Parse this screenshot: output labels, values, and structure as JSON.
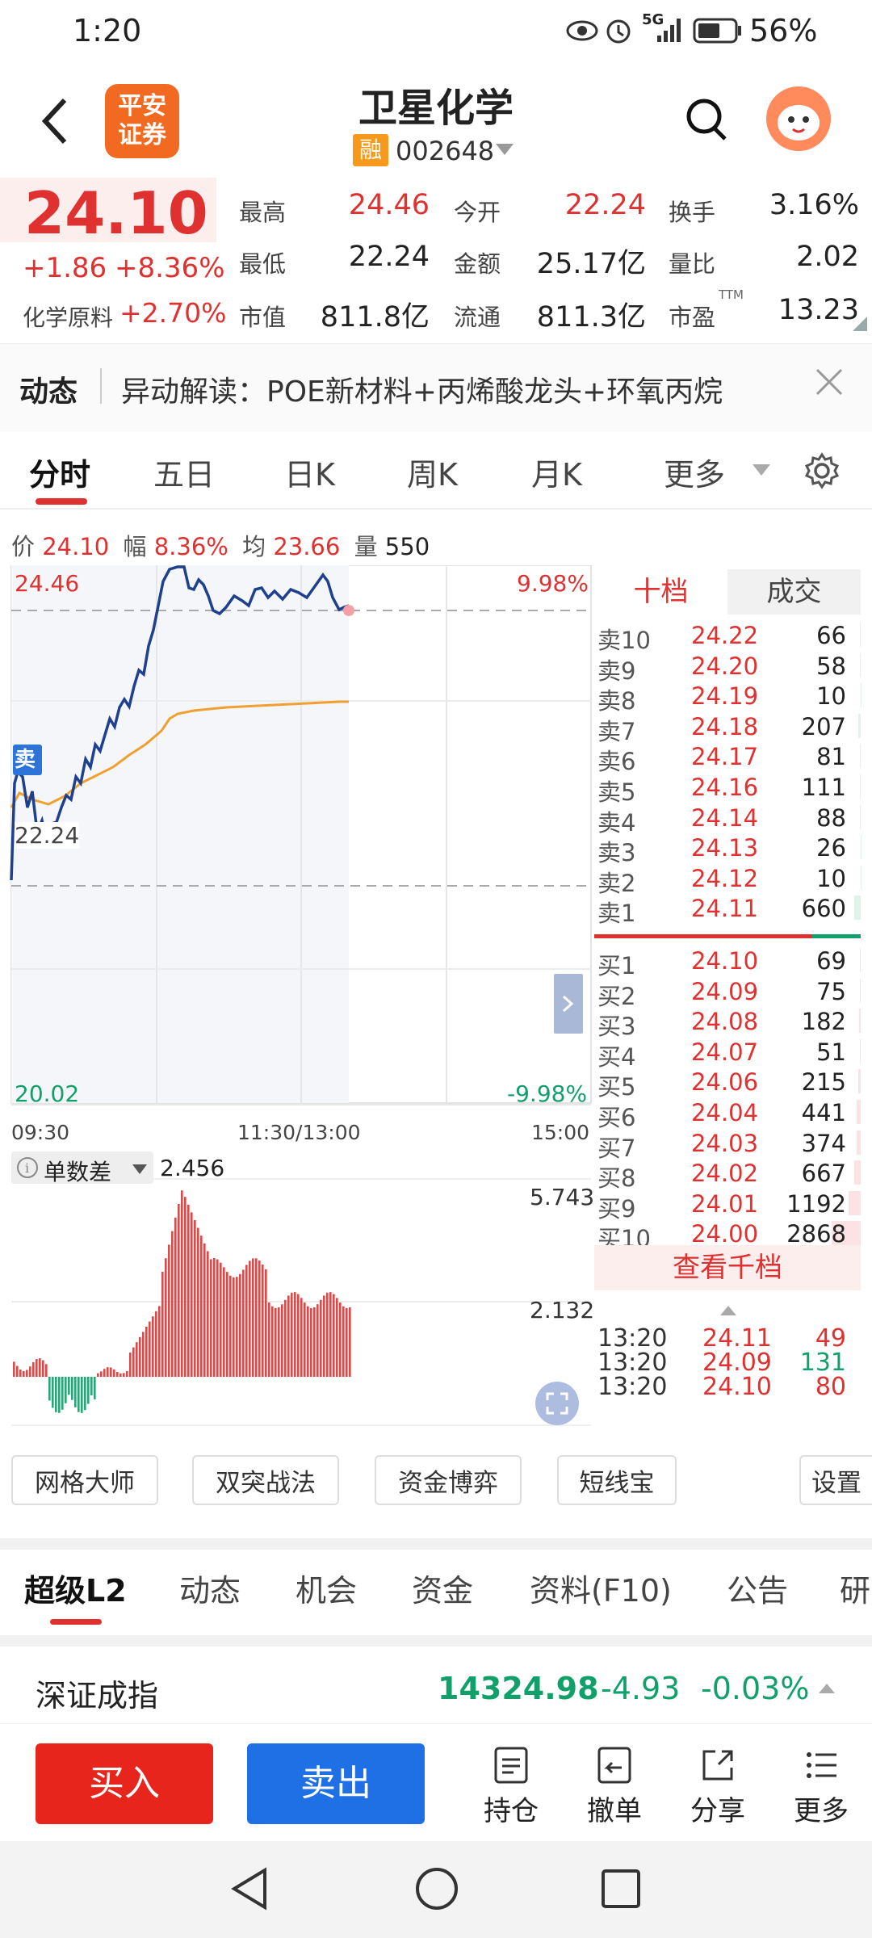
{
  "status": {
    "time": "1:20",
    "battery": "56%",
    "signal": "5G"
  },
  "header": {
    "title": "卫星化学",
    "rong_badge": "融",
    "code": "002648",
    "logo_line1": "平安",
    "logo_line2": "证券"
  },
  "quote": {
    "price": "24.10",
    "change": "+1.86",
    "change_pct": "+8.36%",
    "sector_label": "化学原料",
    "sector_change": "+2.70%",
    "cells": [
      {
        "label": "最高",
        "value": "24.46"
      },
      {
        "label": "今开",
        "value": "22.24"
      },
      {
        "label": "换手",
        "value": "3.16%"
      },
      {
        "label": "最低",
        "value": "22.24"
      },
      {
        "label": "金额",
        "value": "25.17亿"
      },
      {
        "label": "量比",
        "value": "2.02"
      },
      {
        "label": "市值",
        "value": "811.8亿"
      },
      {
        "label": "流通",
        "value": "811.3亿"
      },
      {
        "label": "市盈",
        "value": "13.23",
        "sup": "TTM"
      }
    ]
  },
  "news": {
    "label": "动态",
    "text": "异动解读：POE新材料+丙烯酸龙头+环氧丙烷"
  },
  "tabs": [
    "分时",
    "五日",
    "日K",
    "周K",
    "月K",
    "更多"
  ],
  "chart_header": {
    "price_label": "价",
    "price": "24.10",
    "range_label": "幅",
    "range": "8.36%",
    "avg_label": "均",
    "avg": "23.66",
    "vol_label": "量",
    "vol": "550"
  },
  "chart_labels": {
    "high": "24.46",
    "high_pct": "9.98%",
    "prev_close": "22.24",
    "low": "20.02",
    "low_pct": "-9.98%",
    "t_start": "09:30",
    "t_mid": "11:30/13:00",
    "t_end": "15:00",
    "sell_marker": "卖"
  },
  "indicator": {
    "name": "单数差",
    "value": "2.456",
    "max": "5.743",
    "mid": "2.132"
  },
  "book_tabs": {
    "active": "十档",
    "other": "成交"
  },
  "asks": [
    {
      "label": "卖10",
      "price": "24.22",
      "qty": "66"
    },
    {
      "label": "卖9",
      "price": "24.20",
      "qty": "58"
    },
    {
      "label": "卖8",
      "price": "24.19",
      "qty": "10"
    },
    {
      "label": "卖7",
      "price": "24.18",
      "qty": "207"
    },
    {
      "label": "卖6",
      "price": "24.17",
      "qty": "81"
    },
    {
      "label": "卖5",
      "price": "24.16",
      "qty": "111"
    },
    {
      "label": "卖4",
      "price": "24.14",
      "qty": "88"
    },
    {
      "label": "卖3",
      "price": "24.13",
      "qty": "26"
    },
    {
      "label": "卖2",
      "price": "24.12",
      "qty": "10"
    },
    {
      "label": "卖1",
      "price": "24.11",
      "qty": "660"
    }
  ],
  "bids": [
    {
      "label": "买1",
      "price": "24.10",
      "qty": "69"
    },
    {
      "label": "买2",
      "price": "24.09",
      "qty": "75"
    },
    {
      "label": "买3",
      "price": "24.08",
      "qty": "182"
    },
    {
      "label": "买4",
      "price": "24.07",
      "qty": "51"
    },
    {
      "label": "买5",
      "price": "24.06",
      "qty": "215"
    },
    {
      "label": "买6",
      "price": "24.04",
      "qty": "441"
    },
    {
      "label": "买7",
      "price": "24.03",
      "qty": "374"
    },
    {
      "label": "买8",
      "price": "24.02",
      "qty": "667"
    },
    {
      "label": "买9",
      "price": "24.01",
      "qty": "1192"
    },
    {
      "label": "买10",
      "price": "24.00",
      "qty": "2868"
    }
  ],
  "book_more": "查看千档",
  "trades": [
    {
      "time": "13:20",
      "price": "24.11",
      "qty": "49",
      "color": "red"
    },
    {
      "time": "13:20",
      "price": "24.09",
      "qty": "131",
      "color": "green"
    },
    {
      "time": "13:20",
      "price": "24.10",
      "qty": "80",
      "color": "red"
    }
  ],
  "tools": [
    "网格大师",
    "双突战法",
    "资金博弈",
    "短线宝",
    "设置"
  ],
  "bottom_tabs": [
    "超级L2",
    "动态",
    "机会",
    "资金",
    "资料(F10)",
    "公告",
    "研"
  ],
  "index": {
    "name": "深证成指",
    "value": "14324.98",
    "change": "-4.93",
    "pct": "-0.03%"
  },
  "actions": {
    "buy": "买入",
    "sell": "卖出",
    "hold": "持仓",
    "cancel": "撤单",
    "share": "分享",
    "more": "更多"
  },
  "colors": {
    "up": "#e03131",
    "down": "#12a06a",
    "price_line": "#1f3f8f",
    "avg_line": "#f0a030",
    "buy_btn": "#e8251d",
    "sell_btn": "#1f6fe5"
  }
}
